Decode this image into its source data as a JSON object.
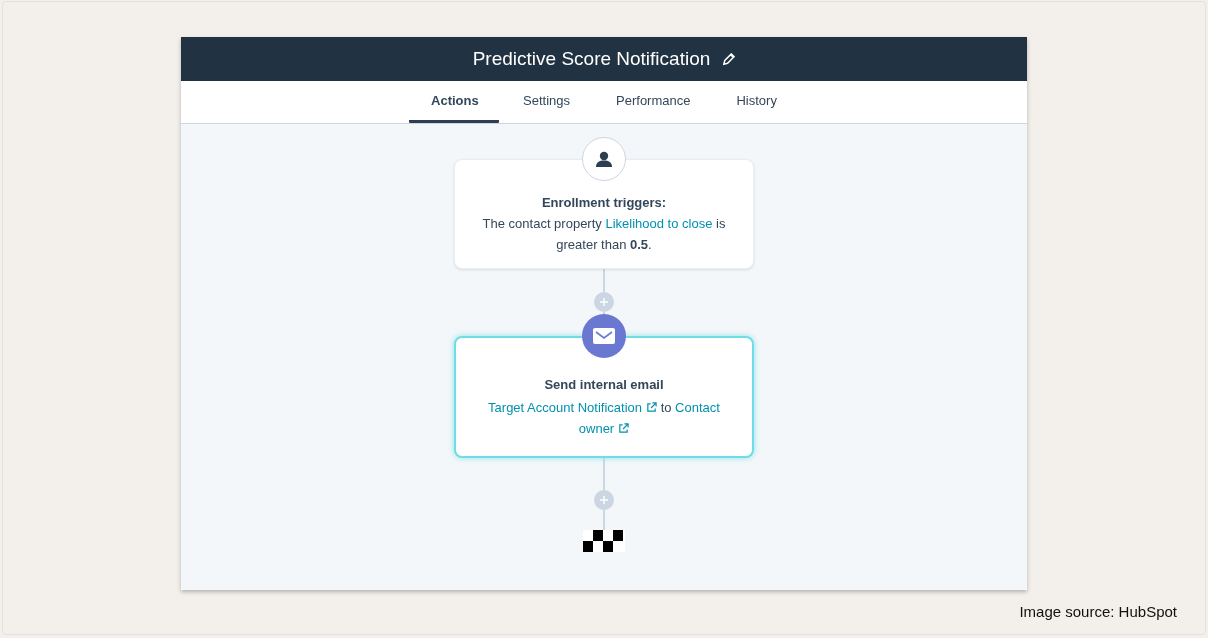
{
  "workflow": {
    "title": "Predictive Score Notification"
  },
  "tabs": [
    {
      "label": "Actions",
      "selected": true
    },
    {
      "label": "Settings",
      "selected": false
    },
    {
      "label": "Performance",
      "selected": false
    },
    {
      "label": "History",
      "selected": false
    }
  ],
  "trigger": {
    "heading": "Enrollment triggers:",
    "text_before": "The contact property",
    "link": "Likelihood to close",
    "text_after": "is greater than **0.5**."
  },
  "action": {
    "heading": "Send internal email",
    "selected": true,
    "link": "Target Account Notification",
    "joiner": "to",
    "recipient": "Contact owner"
  },
  "caption": "Image source: HubSpot"
}
